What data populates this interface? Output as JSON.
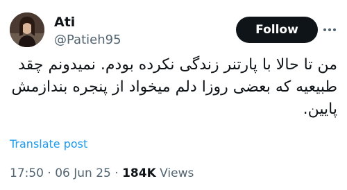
{
  "author": {
    "display_name": "Ati",
    "handle": "@Patieh95"
  },
  "actions": {
    "follow_label": "Follow"
  },
  "tweet": {
    "text": "من تا حالا با پارتنر زندگی نکرده بودم. نمیدونم چقد\nطبیعیه که بعضی روزا دلم میخواد از پنجره بندازمش\nپایین.",
    "translate_label": "Translate post"
  },
  "meta": {
    "time": "17:50",
    "separator": "·",
    "date": "06 Jun 25",
    "views_count": "184K",
    "views_label": "Views"
  },
  "colors": {
    "link": "#1d9bf0",
    "follow_bg": "#0f1419",
    "muted_text": "#536471"
  }
}
